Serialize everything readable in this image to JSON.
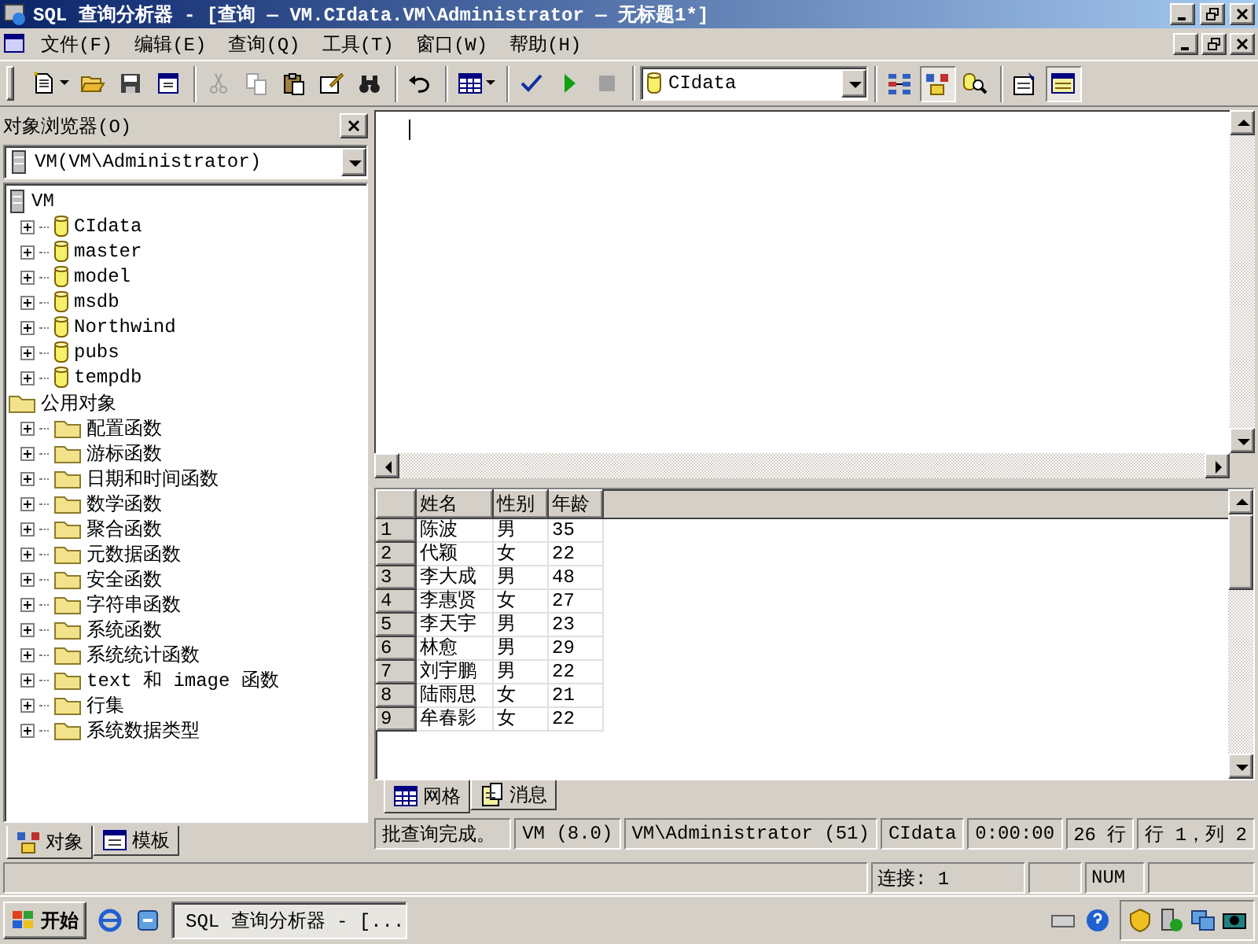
{
  "window": {
    "title": "SQL 查询分析器 - [查询 — VM.CIdata.VM\\Administrator — 无标题1*]"
  },
  "menu": [
    "文件(F)",
    "编辑(E)",
    "查询(Q)",
    "工具(T)",
    "窗口(W)",
    "帮助(H)"
  ],
  "toolbar": {
    "groups": [
      {
        "items": [
          {
            "kind": "new",
            "disabled": false,
            "pressed": false
          },
          {
            "kind": "open",
            "disabled": false,
            "pressed": false
          },
          {
            "kind": "save",
            "disabled": false,
            "pressed": false
          },
          {
            "kind": "script",
            "disabled": false,
            "pressed": false
          }
        ]
      },
      {
        "items": [
          {
            "kind": "cut",
            "disabled": true,
            "pressed": false
          },
          {
            "kind": "copy",
            "disabled": true,
            "pressed": false
          },
          {
            "kind": "paste",
            "disabled": false,
            "pressed": false
          },
          {
            "kind": "clear",
            "disabled": false,
            "pressed": false
          },
          {
            "kind": "find",
            "disabled": false,
            "pressed": false
          }
        ]
      },
      {
        "items": [
          {
            "kind": "undo",
            "disabled": false,
            "pressed": false
          }
        ]
      },
      {
        "items": [
          {
            "kind": "grid",
            "disabled": false,
            "pressed": false
          }
        ]
      },
      {
        "items": [
          {
            "kind": "check",
            "disabled": false,
            "pressed": false
          },
          {
            "kind": "run",
            "disabled": false,
            "pressed": false
          },
          {
            "kind": "stop",
            "disabled": true,
            "pressed": false
          }
        ]
      },
      {
        "items": [
          {
            "kind": "combo",
            "value": "CIdata"
          }
        ]
      },
      {
        "items": [
          {
            "kind": "plan",
            "disabled": false,
            "pressed": false
          },
          {
            "kind": "browser",
            "disabled": false,
            "pressed": true
          },
          {
            "kind": "search",
            "disabled": false,
            "pressed": false
          }
        ]
      },
      {
        "items": [
          {
            "kind": "properties",
            "disabled": false,
            "pressed": false
          },
          {
            "kind": "results",
            "disabled": false,
            "pressed": true
          }
        ]
      }
    ]
  },
  "object_browser": {
    "title": "对象浏览器(O)",
    "server": "VM(VM\\Administrator)",
    "tree": [
      {
        "label": "VM",
        "kind": "server",
        "children": [
          {
            "label": "CIdata",
            "kind": "database",
            "expanded": false
          },
          {
            "label": "master",
            "kind": "database",
            "expanded": false
          },
          {
            "label": "model",
            "kind": "database",
            "expanded": false
          },
          {
            "label": "msdb",
            "kind": "database",
            "expanded": false
          },
          {
            "label": "Northwind",
            "kind": "database",
            "expanded": false
          },
          {
            "label": "pubs",
            "kind": "database",
            "expanded": false
          },
          {
            "label": "tempdb",
            "kind": "database",
            "expanded": false
          }
        ]
      },
      {
        "label": "公用对象",
        "kind": "folder",
        "children": [
          {
            "label": "配置函数",
            "kind": "folder",
            "expanded": false
          },
          {
            "label": "游标函数",
            "kind": "folder",
            "expanded": false
          },
          {
            "label": "日期和时间函数",
            "kind": "folder",
            "expanded": false
          },
          {
            "label": "数学函数",
            "kind": "folder",
            "expanded": false
          },
          {
            "label": "聚合函数",
            "kind": "folder",
            "expanded": false
          },
          {
            "label": "元数据函数",
            "kind": "folder",
            "expanded": false
          },
          {
            "label": "安全函数",
            "kind": "folder",
            "expanded": false
          },
          {
            "label": "字符串函数",
            "kind": "folder",
            "expanded": false
          },
          {
            "label": "系统函数",
            "kind": "folder",
            "expanded": false
          },
          {
            "label": "系统统计函数",
            "kind": "folder",
            "expanded": false
          },
          {
            "label": "text 和 image 函数",
            "kind": "folder",
            "expanded": false
          },
          {
            "label": "行集",
            "kind": "folder",
            "expanded": false
          },
          {
            "label": "系统数据类型",
            "kind": "folder",
            "expanded": false
          }
        ]
      }
    ],
    "tabs": [
      {
        "label": "对象",
        "kind": "objects",
        "selected": true
      },
      {
        "label": "模板",
        "kind": "templates",
        "selected": false
      }
    ]
  },
  "results": {
    "columns": [
      "姓名",
      "性别",
      "年龄"
    ],
    "rows": [
      {
        "number": "1",
        "cells": [
          "陈波",
          "男",
          "35"
        ]
      },
      {
        "number": "2",
        "cells": [
          "代颖",
          "女",
          "22"
        ]
      },
      {
        "number": "3",
        "cells": [
          "李大成",
          "男",
          "48"
        ]
      },
      {
        "number": "4",
        "cells": [
          "李惠贤",
          "女",
          "27"
        ]
      },
      {
        "number": "5",
        "cells": [
          "李天宇",
          "男",
          "23"
        ]
      },
      {
        "number": "6",
        "cells": [
          "林愈",
          "男",
          "29"
        ]
      },
      {
        "number": "7",
        "cells": [
          "刘宇鹏",
          "男",
          "22"
        ]
      },
      {
        "number": "8",
        "cells": [
          "陆雨思",
          "女",
          "21"
        ]
      },
      {
        "number": "9",
        "cells": [
          "牟春影",
          "女",
          "22"
        ]
      }
    ],
    "tabs": [
      {
        "label": "网格",
        "kind": "grid",
        "selected": true
      },
      {
        "label": "消息",
        "kind": "messages",
        "selected": false
      }
    ]
  },
  "query_status": [
    "批查询完成。",
    "VM (8.0)",
    "VM\\Administrator (51)",
    "CIdata",
    "0:00:00",
    "26 行",
    "行 1，列 2"
  ],
  "status_bar": {
    "connections": "连接: 1",
    "num_lock": "NUM"
  },
  "taskbar": {
    "start": "开始",
    "tasks": [
      {
        "label": "SQL 查询分析器 - [...",
        "selected": true
      }
    ]
  }
}
